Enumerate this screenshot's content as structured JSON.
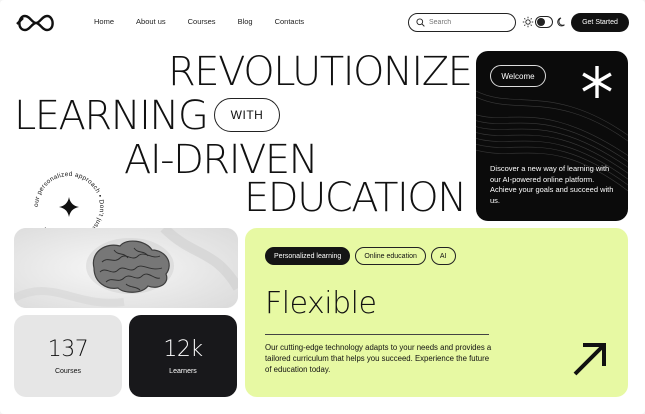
{
  "header": {
    "nav": [
      "Home",
      "About us",
      "Courses",
      "Blog",
      "Contacts"
    ],
    "search_placeholder": "Search",
    "cta_label": "Get Started"
  },
  "hero": {
    "line1": "REVOLUTIONIZE",
    "line2": "LEARNING",
    "with_label": "WITH",
    "line3": "AI-DRIVEN",
    "line4": "EDUCATION",
    "circle_text": "our personalized approach • Don't just study, excel with"
  },
  "welcome_card": {
    "pill_label": "Welcome",
    "description": "Discover a new way of learning with our AI-powered online platform. Achieve your goals and succeed with us."
  },
  "stats": [
    {
      "value": "137",
      "label": "Courses"
    },
    {
      "value": "12k",
      "label": "Learners"
    }
  ],
  "feature_card": {
    "tags": [
      "Personalized learning",
      "Online education",
      "AI"
    ],
    "title": "Flexible",
    "description": "Our cutting-edge technology adapts to your needs and provides a tailored curriculum that helps you succeed. Experience the future of education today."
  },
  "icons": {
    "logo": "infinity-logo-icon",
    "search": "search-icon",
    "theme_light": "sun-icon",
    "theme_dark": "moon-icon",
    "welcome": "asterisk-icon",
    "badge": "sparkle-icon",
    "feature": "arrow-up-right-icon"
  },
  "colors": {
    "accent_green": "#e7f9a3",
    "dark": "#0b0b0b"
  }
}
